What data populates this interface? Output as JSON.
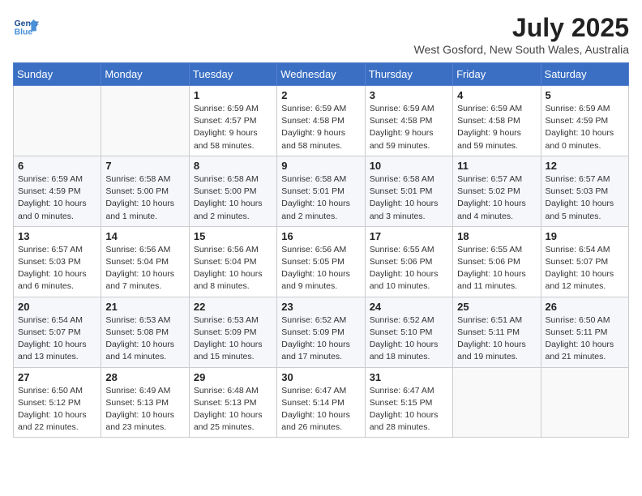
{
  "logo": {
    "line1": "General",
    "line2": "Blue"
  },
  "title": "July 2025",
  "location": "West Gosford, New South Wales, Australia",
  "days_of_week": [
    "Sunday",
    "Monday",
    "Tuesday",
    "Wednesday",
    "Thursday",
    "Friday",
    "Saturday"
  ],
  "weeks": [
    [
      {
        "num": "",
        "sunrise": "",
        "sunset": "",
        "daylight": ""
      },
      {
        "num": "",
        "sunrise": "",
        "sunset": "",
        "daylight": ""
      },
      {
        "num": "1",
        "sunrise": "Sunrise: 6:59 AM",
        "sunset": "Sunset: 4:57 PM",
        "daylight": "Daylight: 9 hours and 58 minutes."
      },
      {
        "num": "2",
        "sunrise": "Sunrise: 6:59 AM",
        "sunset": "Sunset: 4:58 PM",
        "daylight": "Daylight: 9 hours and 58 minutes."
      },
      {
        "num": "3",
        "sunrise": "Sunrise: 6:59 AM",
        "sunset": "Sunset: 4:58 PM",
        "daylight": "Daylight: 9 hours and 59 minutes."
      },
      {
        "num": "4",
        "sunrise": "Sunrise: 6:59 AM",
        "sunset": "Sunset: 4:58 PM",
        "daylight": "Daylight: 9 hours and 59 minutes."
      },
      {
        "num": "5",
        "sunrise": "Sunrise: 6:59 AM",
        "sunset": "Sunset: 4:59 PM",
        "daylight": "Daylight: 10 hours and 0 minutes."
      }
    ],
    [
      {
        "num": "6",
        "sunrise": "Sunrise: 6:59 AM",
        "sunset": "Sunset: 4:59 PM",
        "daylight": "Daylight: 10 hours and 0 minutes."
      },
      {
        "num": "7",
        "sunrise": "Sunrise: 6:58 AM",
        "sunset": "Sunset: 5:00 PM",
        "daylight": "Daylight: 10 hours and 1 minute."
      },
      {
        "num": "8",
        "sunrise": "Sunrise: 6:58 AM",
        "sunset": "Sunset: 5:00 PM",
        "daylight": "Daylight: 10 hours and 2 minutes."
      },
      {
        "num": "9",
        "sunrise": "Sunrise: 6:58 AM",
        "sunset": "Sunset: 5:01 PM",
        "daylight": "Daylight: 10 hours and 2 minutes."
      },
      {
        "num": "10",
        "sunrise": "Sunrise: 6:58 AM",
        "sunset": "Sunset: 5:01 PM",
        "daylight": "Daylight: 10 hours and 3 minutes."
      },
      {
        "num": "11",
        "sunrise": "Sunrise: 6:57 AM",
        "sunset": "Sunset: 5:02 PM",
        "daylight": "Daylight: 10 hours and 4 minutes."
      },
      {
        "num": "12",
        "sunrise": "Sunrise: 6:57 AM",
        "sunset": "Sunset: 5:03 PM",
        "daylight": "Daylight: 10 hours and 5 minutes."
      }
    ],
    [
      {
        "num": "13",
        "sunrise": "Sunrise: 6:57 AM",
        "sunset": "Sunset: 5:03 PM",
        "daylight": "Daylight: 10 hours and 6 minutes."
      },
      {
        "num": "14",
        "sunrise": "Sunrise: 6:56 AM",
        "sunset": "Sunset: 5:04 PM",
        "daylight": "Daylight: 10 hours and 7 minutes."
      },
      {
        "num": "15",
        "sunrise": "Sunrise: 6:56 AM",
        "sunset": "Sunset: 5:04 PM",
        "daylight": "Daylight: 10 hours and 8 minutes."
      },
      {
        "num": "16",
        "sunrise": "Sunrise: 6:56 AM",
        "sunset": "Sunset: 5:05 PM",
        "daylight": "Daylight: 10 hours and 9 minutes."
      },
      {
        "num": "17",
        "sunrise": "Sunrise: 6:55 AM",
        "sunset": "Sunset: 5:06 PM",
        "daylight": "Daylight: 10 hours and 10 minutes."
      },
      {
        "num": "18",
        "sunrise": "Sunrise: 6:55 AM",
        "sunset": "Sunset: 5:06 PM",
        "daylight": "Daylight: 10 hours and 11 minutes."
      },
      {
        "num": "19",
        "sunrise": "Sunrise: 6:54 AM",
        "sunset": "Sunset: 5:07 PM",
        "daylight": "Daylight: 10 hours and 12 minutes."
      }
    ],
    [
      {
        "num": "20",
        "sunrise": "Sunrise: 6:54 AM",
        "sunset": "Sunset: 5:07 PM",
        "daylight": "Daylight: 10 hours and 13 minutes."
      },
      {
        "num": "21",
        "sunrise": "Sunrise: 6:53 AM",
        "sunset": "Sunset: 5:08 PM",
        "daylight": "Daylight: 10 hours and 14 minutes."
      },
      {
        "num": "22",
        "sunrise": "Sunrise: 6:53 AM",
        "sunset": "Sunset: 5:09 PM",
        "daylight": "Daylight: 10 hours and 15 minutes."
      },
      {
        "num": "23",
        "sunrise": "Sunrise: 6:52 AM",
        "sunset": "Sunset: 5:09 PM",
        "daylight": "Daylight: 10 hours and 17 minutes."
      },
      {
        "num": "24",
        "sunrise": "Sunrise: 6:52 AM",
        "sunset": "Sunset: 5:10 PM",
        "daylight": "Daylight: 10 hours and 18 minutes."
      },
      {
        "num": "25",
        "sunrise": "Sunrise: 6:51 AM",
        "sunset": "Sunset: 5:11 PM",
        "daylight": "Daylight: 10 hours and 19 minutes."
      },
      {
        "num": "26",
        "sunrise": "Sunrise: 6:50 AM",
        "sunset": "Sunset: 5:11 PM",
        "daylight": "Daylight: 10 hours and 21 minutes."
      }
    ],
    [
      {
        "num": "27",
        "sunrise": "Sunrise: 6:50 AM",
        "sunset": "Sunset: 5:12 PM",
        "daylight": "Daylight: 10 hours and 22 minutes."
      },
      {
        "num": "28",
        "sunrise": "Sunrise: 6:49 AM",
        "sunset": "Sunset: 5:13 PM",
        "daylight": "Daylight: 10 hours and 23 minutes."
      },
      {
        "num": "29",
        "sunrise": "Sunrise: 6:48 AM",
        "sunset": "Sunset: 5:13 PM",
        "daylight": "Daylight: 10 hours and 25 minutes."
      },
      {
        "num": "30",
        "sunrise": "Sunrise: 6:47 AM",
        "sunset": "Sunset: 5:14 PM",
        "daylight": "Daylight: 10 hours and 26 minutes."
      },
      {
        "num": "31",
        "sunrise": "Sunrise: 6:47 AM",
        "sunset": "Sunset: 5:15 PM",
        "daylight": "Daylight: 10 hours and 28 minutes."
      },
      {
        "num": "",
        "sunrise": "",
        "sunset": "",
        "daylight": ""
      },
      {
        "num": "",
        "sunrise": "",
        "sunset": "",
        "daylight": ""
      }
    ]
  ]
}
